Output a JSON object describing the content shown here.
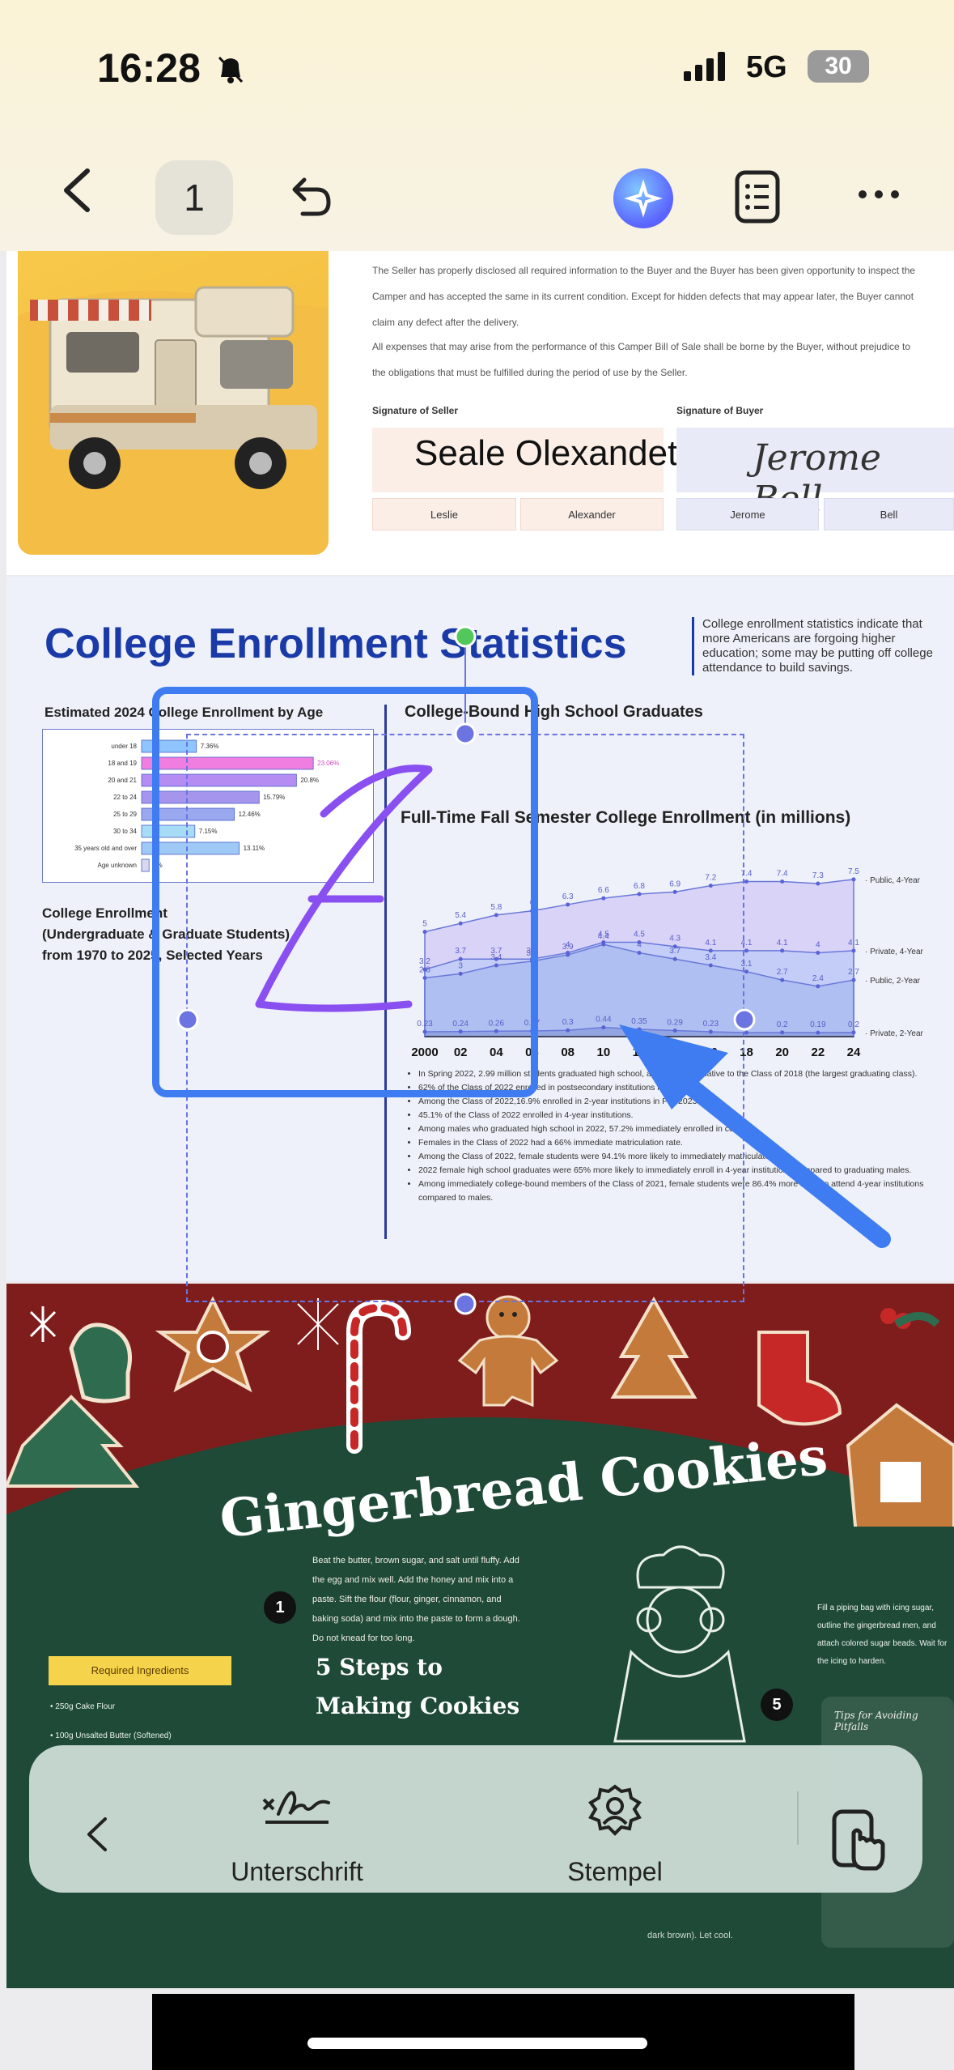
{
  "status_bar": {
    "time": "16:28",
    "network": "5G",
    "battery": "30"
  },
  "nav": {
    "page_number": "1"
  },
  "page1": {
    "para1": "The Seller has properly disclosed all required information to the Buyer and the Buyer has been given opportunity to inspect the Camper and has accepted the same in its current condition. Except for hidden defects that may appear later, the Buyer cannot claim any defect after the delivery.",
    "para2": "All expenses that may arise from the performance of this Camper Bill of Sale shall be borne by the Buyer, without prejudice to the obligations that must be fulfilled during the period of use by the Seller.",
    "seller_label": "Signature of Seller",
    "buyer_label": "Signature of Buyer",
    "seller_signature": "Seale Olexandet",
    "buyer_signature": "Jerome Bell",
    "seller_first": "Leslie",
    "seller_last": "Alexander",
    "buyer_first": "Jerome",
    "buyer_last": "Bell"
  },
  "page2": {
    "title": "College Enrollment Statistics",
    "description": "College enrollment statistics indicate that more Americans are forgoing higher education; some may be putting off college attendance to build savings.",
    "age_chart_title": "Estimated 2024 College Enrollment by Age",
    "hs_title": "College-Bound High School Graduates",
    "enroll_label_1": "College Enrollment",
    "enroll_label_2": "(Undergraduate & Graduate Students)",
    "enroll_label_3": "from 1970 to 2025, Selected Years",
    "ft_title": "Full-Time Fall Semester College Enrollment (in millions)",
    "bullets": [
      "In Spring 2022, 2.99 million students graduated high school, a 7% decline relative to the Class of 2018 (the largest graduating class).",
      "62% of the Class of 2022 enrolled in postsecondary institutions in Fall 2022.",
      "Among the Class of 2022,16.9% enrolled in 2-year institutions in Fall 2023.",
      "45.1% of the Class of 2022 enrolled in 4-year institutions.",
      "Among males who graduated high school in 2022, 57.2% immediately enrolled in college.",
      "Females in the Class of 2022 had a 66% immediate matriculation rate.",
      "Among the Class of 2022, female students were 94.1% more likely to immediately matriculate.",
      "2022 female high school graduates were 65% more likely to immediately enroll in 4-year institutions compared to graduating males.",
      "Among immediately college-bound members of the Class of 2021, female students were 86.4% more likely to attend 4-year institutions compared to males."
    ]
  },
  "age_chart": {
    "categories": [
      "under 18",
      "18 and 19",
      "20 and 21",
      "22 to 24",
      "25 to 29",
      "30 to 34",
      "35 years old and over",
      "Age unknown"
    ],
    "values": [
      "7.36%",
      "23.06%",
      "20.8%",
      "15.79%",
      "12.46%",
      "7.15%",
      "13.11%",
      "1%"
    ],
    "numbers": [
      7.36,
      23.06,
      20.8,
      15.79,
      12.46,
      7.15,
      13.11,
      1.0
    ],
    "colors": [
      "#8ec5ff",
      "#f07ee0",
      "#b48cf2",
      "#a695ec",
      "#9aa8ef",
      "#a7dcf7",
      "#9ec9f6",
      "#d8d8ef"
    ]
  },
  "chart_data": {
    "type": "area",
    "title": "Full-Time Fall Semester College Enrollment (in millions)",
    "x": [
      "2000",
      "02",
      "04",
      "06",
      "08",
      "10",
      "12",
      "14",
      "16",
      "18",
      "20",
      "22",
      "24"
    ],
    "series": [
      {
        "name": "Public, 4-Year",
        "values": [
          5.0,
          5.4,
          5.8,
          6.0,
          6.3,
          6.6,
          6.8,
          6.9,
          7.2,
          7.4,
          7.4,
          7.3,
          7.5
        ]
      },
      {
        "name": "Private, 4-Year",
        "values": [
          3.2,
          3.7,
          3.7,
          3.7,
          4.0,
          4.5,
          4.5,
          4.3,
          4.1,
          4.1,
          4.1,
          4.0,
          4.1
        ]
      },
      {
        "name": "Public, 2-Year",
        "values": [
          2.8,
          3.0,
          3.4,
          3.6,
          3.9,
          4.4,
          4.0,
          3.7,
          3.4,
          3.1,
          2.7,
          2.4,
          2.7
        ]
      },
      {
        "name": "Private, 2-Year",
        "values": [
          0.23,
          0.24,
          0.26,
          0.27,
          0.3,
          0.44,
          0.35,
          0.29,
          0.23,
          0.19,
          0.2,
          0.19,
          0.2
        ]
      }
    ],
    "ylim": [
      0,
      8.5
    ],
    "colors": [
      "#c9b9f7",
      "#b0c8f5",
      "#9fb4ef",
      "#7a8fd6"
    ]
  },
  "page3": {
    "title": "Gingerbread Cookies",
    "steps_text": "Beat the butter, brown sugar, and salt until fluffy. Add the egg and mix well. Add the honey and mix into a paste. Sift the flour (flour, ginger, cinnamon, and baking soda) and mix into the paste to form a dough. Do not knead for too long.",
    "steps_title_1": "5 Steps to",
    "steps_title_2": "Making Cookies",
    "ingredients_label": "Required Ingredients",
    "ingredient_1": "• 250g Cake Flour",
    "ingredient_2": "• 100g Unsalted Butter (Softened)",
    "right_text": "Fill a piping bag with icing sugar, outline the gingerbread men, and attach colored sugar beads. Wait for the icing to harden.",
    "tips_title": "Tips for Avoiding Pitfalls",
    "badge_1": "1",
    "badge_5": "5",
    "faint_1": "dark brown). Let cool."
  },
  "toolbar": {
    "signature_label": "Unterschrift",
    "stamp_label": "Stempel"
  },
  "colors": {
    "accent_blue": "#3f7cf2",
    "annotation_purple": "#8a4ff0",
    "title_blue": "#1a3aa8",
    "cookie_red": "#7f1d1d",
    "cookie_green": "#1f4a38"
  }
}
